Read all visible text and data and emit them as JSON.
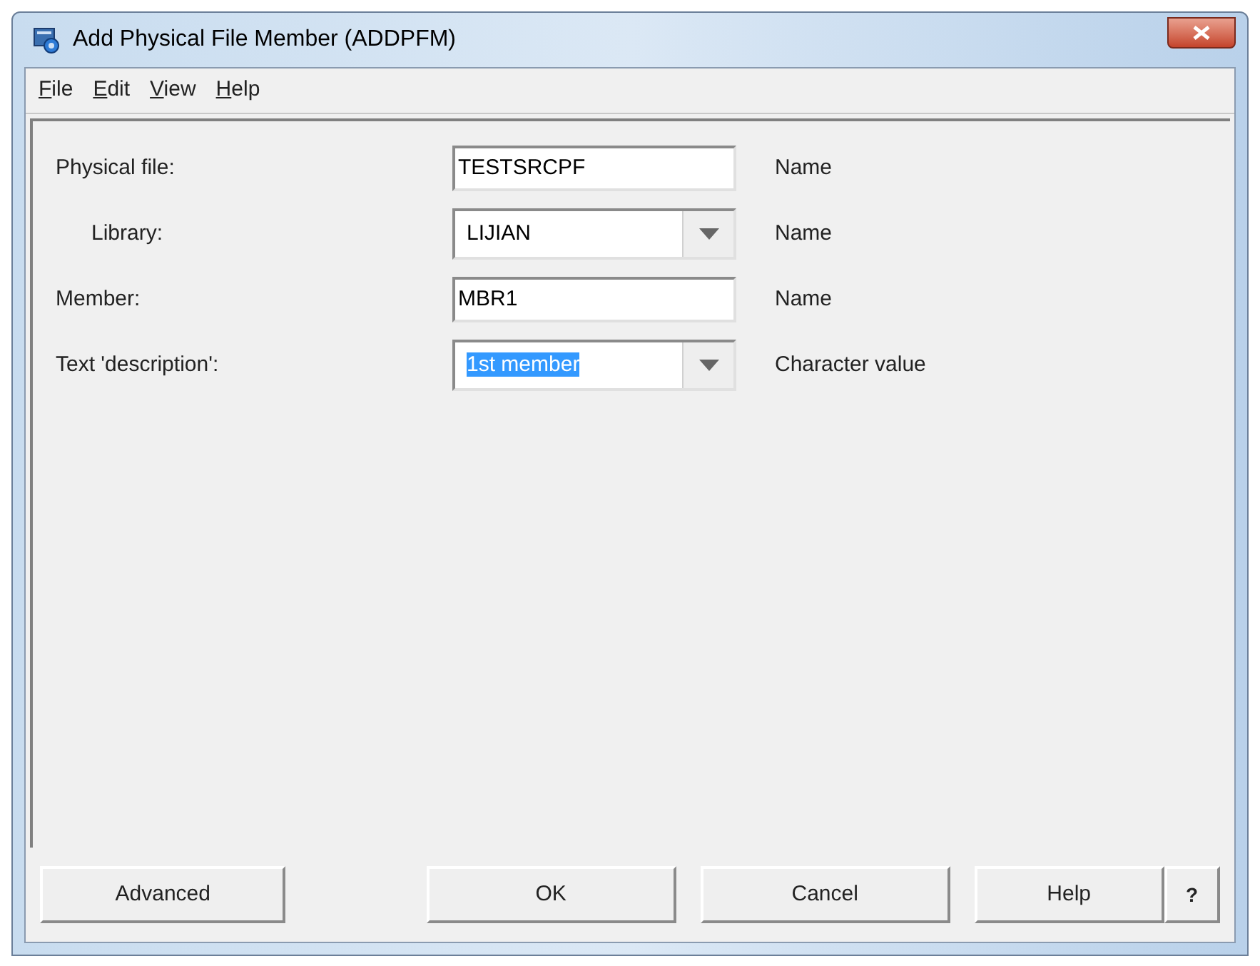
{
  "window": {
    "title": "Add Physical File Member (ADDPFM)"
  },
  "menu": [
    "File",
    "Edit",
    "View",
    "Help"
  ],
  "fields": [
    {
      "label": "Physical file:",
      "kind": "text",
      "value": "TESTSRCPF",
      "hint": "Name",
      "text_selected": false,
      "children": [
        {
          "label": "Library:",
          "kind": "combo",
          "value": "LIJIAN",
          "hint": "Name",
          "text_selected": false
        }
      ]
    },
    {
      "label": "Member:",
      "kind": "text",
      "value": "MBR1",
      "hint": "Name",
      "text_selected": false
    },
    {
      "label": "Text 'description':",
      "kind": "combo",
      "value": "1st member",
      "hint": "Character value",
      "text_selected": true
    }
  ],
  "buttons": {
    "left": "Advanced",
    "right": [
      "OK",
      "Cancel",
      "Help"
    ],
    "help_icon": "?"
  }
}
